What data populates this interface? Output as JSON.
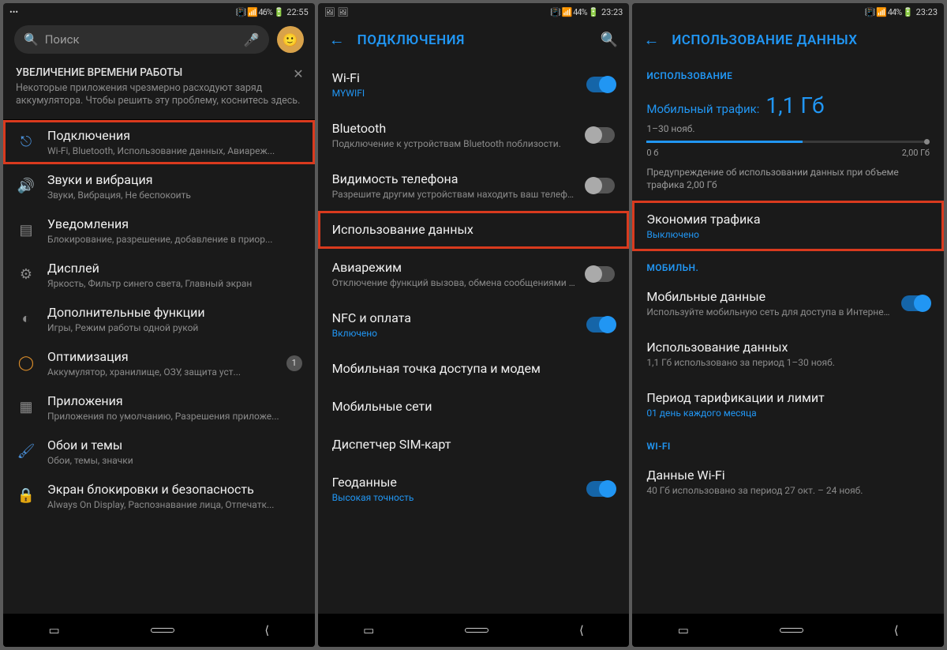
{
  "phone1": {
    "status": {
      "left_icons": "•••",
      "icons": "📳 📶 46% 🔋",
      "time": "22:55"
    },
    "search_placeholder": "Поиск",
    "banner": {
      "title": "УВЕЛИЧЕНИЕ ВРЕМЕНИ РАБОТЫ",
      "desc": "Некоторые приложения чрезмерно расходуют заряд аккумулятора. Чтобы решить эту проблему, коснитесь здесь."
    },
    "items": [
      {
        "label": "Подключения",
        "sub": "Wi-Fi, Bluetooth, Использование данных, Авиареж..."
      },
      {
        "label": "Звуки и вибрация",
        "sub": "Звуки, Вибрация, Не беспокоить"
      },
      {
        "label": "Уведомления",
        "sub": "Блокирование, разрешение, добавление в приор..."
      },
      {
        "label": "Дисплей",
        "sub": "Яркость, Фильтр синего света, Главный экран"
      },
      {
        "label": "Дополнительные функции",
        "sub": "Игры, Режим работы одной рукой"
      },
      {
        "label": "Оптимизация",
        "sub": "Аккумулятор, хранилище, ОЗУ, защита уст...",
        "badge": "1"
      },
      {
        "label": "Приложения",
        "sub": "Приложения по умолчанию, Разрешения приложе..."
      },
      {
        "label": "Обои и темы",
        "sub": "Обои, темы, значки"
      },
      {
        "label": "Экран блокировки и безопасность",
        "sub": "Always On Display, Распознавание лица, Отпечатк..."
      }
    ]
  },
  "phone2": {
    "status": {
      "left_icons": "🖼 🖼",
      "icons": "📳 📶 44% 🔋",
      "time": "23:23"
    },
    "header": "ПОДКЛЮЧЕНИЯ",
    "items": [
      {
        "label": "Wi-Fi",
        "sub": "MYWIFI",
        "sub_blue": true,
        "toggle": "on"
      },
      {
        "label": "Bluetooth",
        "sub": "Подключение к устройствам Bluetooth поблизости.",
        "toggle": "off"
      },
      {
        "label": "Видимость телефона",
        "sub": "Разрешите другим устройствам находить ваш телефон и передавать файлы.",
        "toggle": "off"
      },
      {
        "label": "Использование данных"
      },
      {
        "label": "Авиарежим",
        "sub": "Отключение функций вызова, обмена сообщениями и мобильных данных.",
        "toggle": "off"
      },
      {
        "label": "NFC и оплата",
        "sub": "Включено",
        "sub_blue": true,
        "toggle": "on"
      },
      {
        "label": "Мобильная точка доступа и модем"
      },
      {
        "label": "Мобильные сети"
      },
      {
        "label": "Диспетчер SIM-карт"
      },
      {
        "label": "Геоданные",
        "sub": "Высокая точность",
        "sub_blue": true,
        "toggle": "on"
      }
    ]
  },
  "phone3": {
    "status": {
      "left_icons": "",
      "icons": "📳 📶 44% 🔋",
      "time": "23:23"
    },
    "header": "ИСПОЛЬЗОВАНИЕ ДАННЫХ",
    "section1": "ИСПОЛЬЗОВАНИЕ",
    "usage": {
      "label": "Мобильный трафик:",
      "value": "1,1 Гб",
      "dates": "1–30 нояб.",
      "range_low": "0 б",
      "range_high": "2,00 Гб",
      "warn": "Предупреждение об использовании данных при объеме трафика 2,00 Гб"
    },
    "saver": {
      "label": "Экономия трафика",
      "sub": "Выключено"
    },
    "section2": "МОБИЛЬН.",
    "mobile": [
      {
        "label": "Мобильные данные",
        "sub": "Используйте мобильную сеть для доступа в Интернет.",
        "toggle": "on"
      },
      {
        "label": "Использование данных",
        "sub": "1,1 Гб использовано за период 1–30 нояб."
      },
      {
        "label": "Период тарификации и лимит",
        "sub": "01 день каждого месяца",
        "sub_blue": true
      }
    ],
    "section3": "WI-FI",
    "wifi": [
      {
        "label": "Данные Wi-Fi",
        "sub": "40 Гб использовано за период 27 окт. – 24 нояб."
      }
    ]
  }
}
